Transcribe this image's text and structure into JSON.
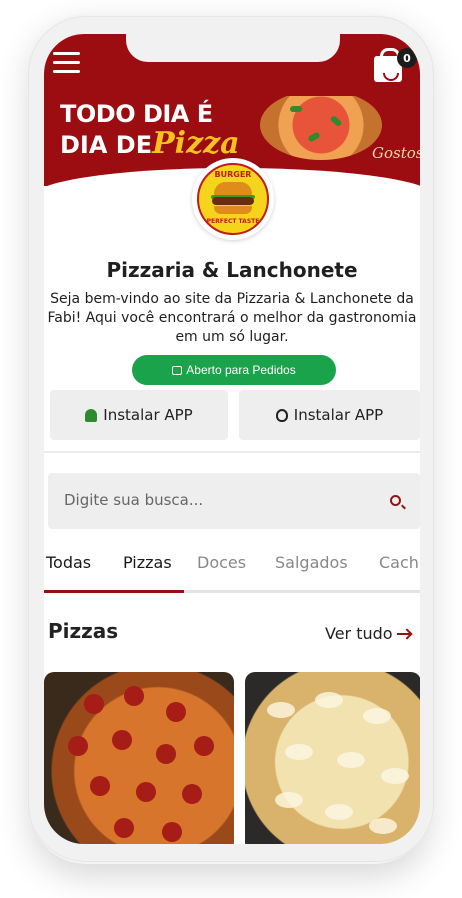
{
  "header": {
    "menu_icon": "hamburger-menu-icon",
    "cart_icon": "shopping-bag-icon",
    "cart_count": "0"
  },
  "banner": {
    "line1": "TODO DIA É",
    "line2_prefix": "DIA DE",
    "line2_script": "Pizza",
    "tagline": "Gostosa"
  },
  "logo": {
    "top_text": "BURGER",
    "bottom_text": "PERFECT TASTE"
  },
  "store": {
    "name": "Pizzaria & Lanchonete",
    "description": "Seja bem-vindo ao site da Pizzaria & Lanchonete da Fabi! Aqui você encontrará o melhor da gastronomia em um só lugar.",
    "status": "Aberto para Pedidos"
  },
  "apps": {
    "android_label": "Instalar APP",
    "ios_label": "Instalar APP"
  },
  "search": {
    "placeholder": "Digite sua busca..."
  },
  "tabs": [
    {
      "label": "Todas",
      "active": true
    },
    {
      "label": "Pizzas",
      "active": true
    },
    {
      "label": "Doces",
      "active": false
    },
    {
      "label": "Salgados",
      "active": false
    },
    {
      "label": "Cach",
      "active": false
    }
  ],
  "section": {
    "title": "Pizzas",
    "see_all": "Ver tudo"
  },
  "colors": {
    "brand": "#9b0d11",
    "status_green": "#1aa34a"
  }
}
